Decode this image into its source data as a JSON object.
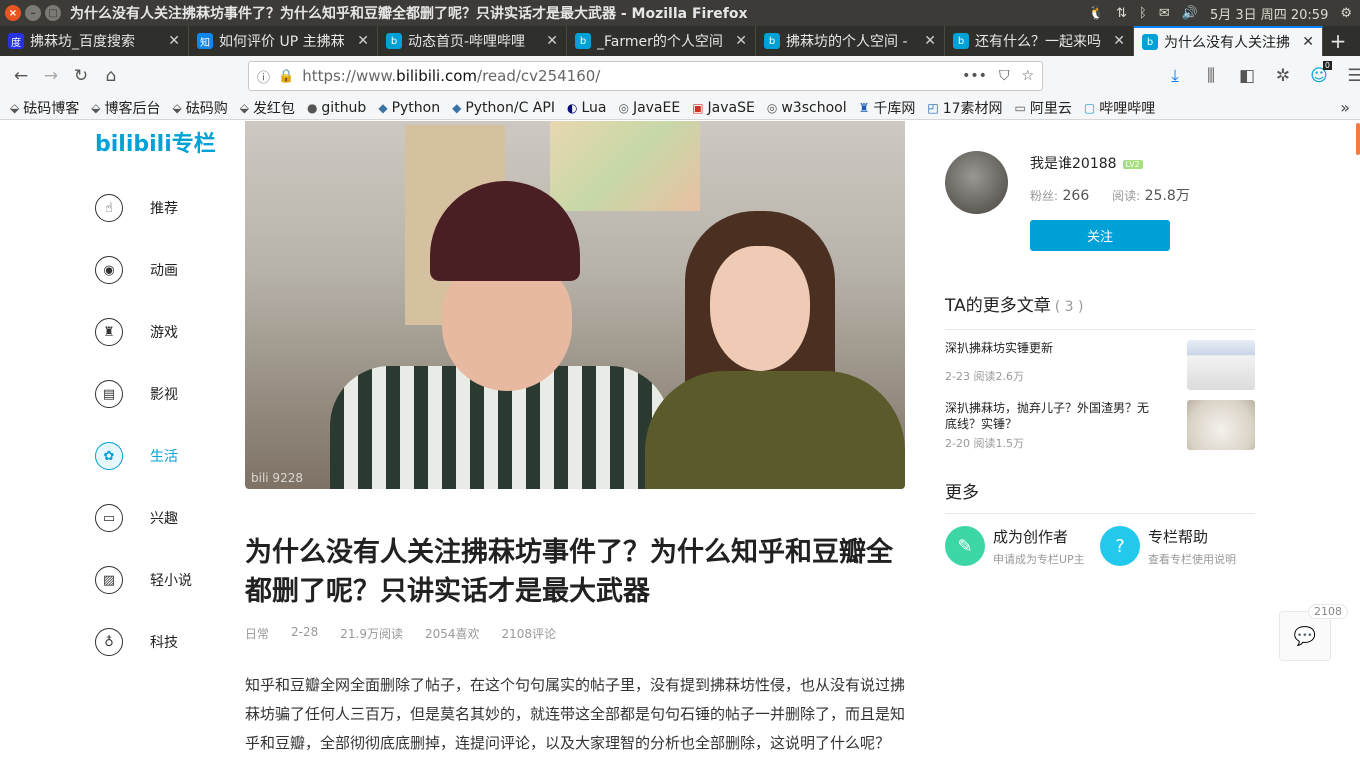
{
  "window": {
    "title": "为什么没有人关注拂菻坊事件了？为什么知乎和豆瓣全都删了呢？只讲实话才是最大武器 - Mozilla Firefox",
    "tray_datetime": "5月 3日 周四 20:59"
  },
  "tabs": [
    {
      "label": "拂菻坊_百度搜索",
      "fav": "度"
    },
    {
      "label": "如何评价 UP 主拂菻",
      "fav": "知"
    },
    {
      "label": "动态首页-哔哩哔哩",
      "fav": "b"
    },
    {
      "label": "_Farmer的个人空间",
      "fav": "b"
    },
    {
      "label": "拂菻坊的个人空间 -",
      "fav": "b"
    },
    {
      "label": "还有什么？一起来吗",
      "fav": "b"
    },
    {
      "label": "为什么没有人关注拂",
      "fav": "b"
    }
  ],
  "url": {
    "prefix": "https://www.",
    "domain": "bilibili.com",
    "path": "/read/cv254160/"
  },
  "bookmarks": [
    "砝码博客",
    "博客后台",
    "砝码购",
    "发红包",
    "github",
    "Python",
    "Python/C API",
    "Lua",
    "JavaEE",
    "JavaSE",
    "w3school",
    "千库网",
    "17素材网",
    "阿里云",
    "哔哩哔哩"
  ],
  "toolbar_badge": "0",
  "site": {
    "logo": "bilibili专栏"
  },
  "sidenav": [
    {
      "label": "推荐",
      "icon": "☝"
    },
    {
      "label": "动画",
      "icon": "◉"
    },
    {
      "label": "游戏",
      "icon": "♜"
    },
    {
      "label": "影视",
      "icon": "▤"
    },
    {
      "label": "生活",
      "icon": "✿"
    },
    {
      "label": "兴趣",
      "icon": "▭"
    },
    {
      "label": "轻小说",
      "icon": "▨"
    },
    {
      "label": "科技",
      "icon": "♁"
    }
  ],
  "hero": {
    "watermark": "bili 9228"
  },
  "article": {
    "title": "为什么没有人关注拂菻坊事件了？为什么知乎和豆瓣全都删了呢？只讲实话才是最大武器",
    "category": "日常",
    "date": "2-28",
    "views": "21.9万阅读",
    "likes": "2054喜欢",
    "comments": "2108评论",
    "body": "知乎和豆瓣全网全面删除了帖子，在这个句句属实的帖子里，没有提到拂菻坊性侵，也从没有说过拂菻坊骗了任何人三百万，但是莫名其妙的，就连带这全部都是句句石锤的帖子一并删除了，而且是知乎和豆瓣，全部彻彻底底删掉，连提问评论，以及大家理智的分析也全部删除，这说明了什么呢？"
  },
  "author": {
    "name": "我是谁20188",
    "level": "LV2",
    "fans_label": "粉丝:",
    "fans": "266",
    "reads_label": "阅读:",
    "reads": "25.8万",
    "follow_label": "关注"
  },
  "more_articles": {
    "heading": "TA的更多文章",
    "count": "( 3 )",
    "items": [
      {
        "title": "深扒拂菻坊实锤更新",
        "meta": "2-23 阅读2.6万"
      },
      {
        "title": "深扒拂菻坊，抛弃儿子？外国渣男？无底线？实锤？",
        "meta": "2-20 阅读1.5万"
      }
    ]
  },
  "more": {
    "heading": "更多",
    "cards": [
      {
        "title": "成为创作者",
        "sub": "申请成为专栏UP主",
        "icon": "✎"
      },
      {
        "title": "专栏帮助",
        "sub": "查看专栏使用说明",
        "icon": "?"
      }
    ]
  },
  "comment_float": {
    "count": "2108"
  }
}
